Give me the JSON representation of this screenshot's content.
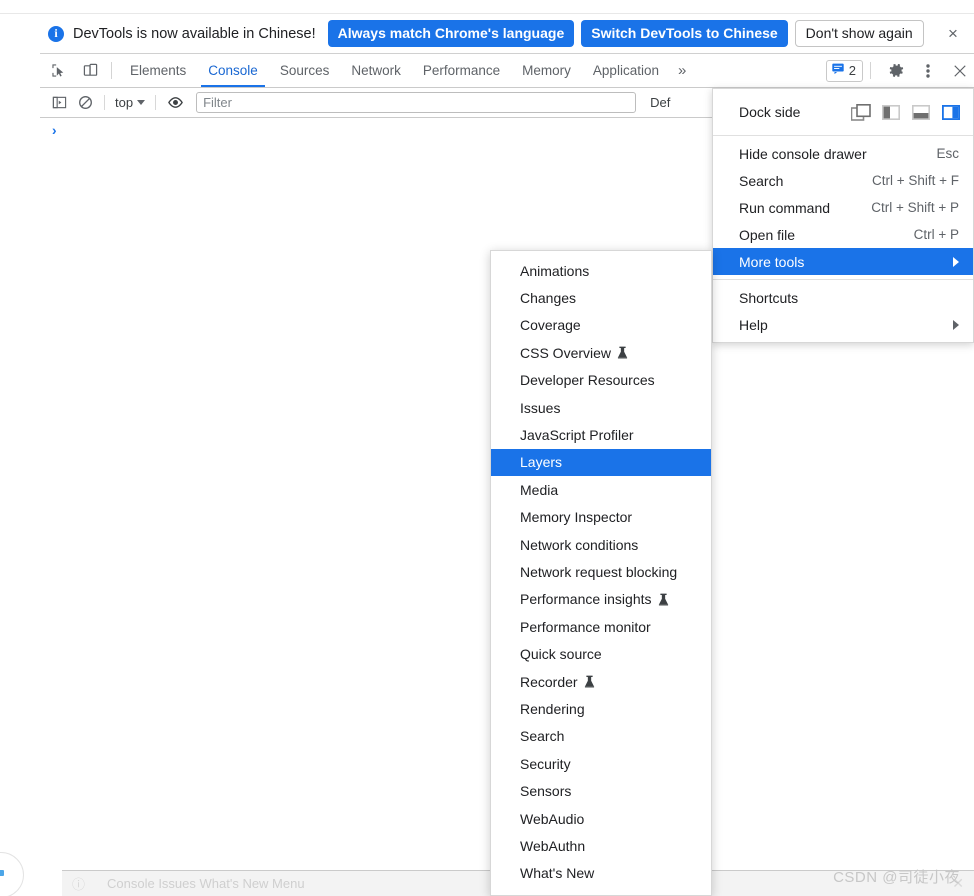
{
  "notification": {
    "icon": "info-icon",
    "message": "DevTools is now available in Chinese!",
    "primary_button_1": "Always match Chrome's language",
    "primary_button_2": "Switch DevTools to Chinese",
    "secondary_button": "Don't show again",
    "close_icon": "×",
    "accent_color": "#1a73e8"
  },
  "tabbar": {
    "inspect_icon": "inspect-element-icon",
    "device_icon": "device-toolbar-icon",
    "tabs": [
      {
        "label": "Elements",
        "active": false
      },
      {
        "label": "Console",
        "active": true
      },
      {
        "label": "Sources",
        "active": false
      },
      {
        "label": "Network",
        "active": false
      },
      {
        "label": "Performance",
        "active": false
      },
      {
        "label": "Memory",
        "active": false
      },
      {
        "label": "Application",
        "active": false
      }
    ],
    "overflow_label": "»",
    "issues_count": "2",
    "issues_icon": "issues-message-icon",
    "settings_icon": "gear-icon",
    "more_icon": "kebab-menu-icon",
    "close_icon": "✕"
  },
  "console_toolbar": {
    "sidebar_icon": "console-sidebar-icon",
    "clear_icon": "clear-console-icon",
    "context_selector": "top",
    "eye_icon": "live-expression-eye-icon",
    "filter_placeholder": "Filter",
    "filter_value": "",
    "levels_label": "Def"
  },
  "console_body": {
    "prompt": "›"
  },
  "bottom_drawer": {
    "info_icon": "info-icon",
    "text": "Console  Issues  What's New  Menu",
    "close_icon": "✕"
  },
  "main_menu": {
    "dock_side": {
      "label": "Dock side",
      "options": [
        {
          "name": "undock-into-separate-window",
          "selected": false
        },
        {
          "name": "dock-to-left",
          "selected": false
        },
        {
          "name": "dock-to-bottom",
          "selected": false
        },
        {
          "name": "dock-to-right",
          "selected": true
        }
      ],
      "selected_color": "#1a73e8"
    },
    "items": [
      {
        "label": "Hide console drawer",
        "shortcut": "Esc",
        "selected": false,
        "has_submenu": false
      },
      {
        "label": "Search",
        "shortcut": "Ctrl + Shift + F",
        "selected": false,
        "has_submenu": false
      },
      {
        "label": "Run command",
        "shortcut": "Ctrl + Shift + P",
        "selected": false,
        "has_submenu": false
      },
      {
        "label": "Open file",
        "shortcut": "Ctrl + P",
        "selected": false,
        "has_submenu": false
      },
      {
        "label": "More tools",
        "shortcut": "",
        "selected": true,
        "has_submenu": true
      }
    ],
    "items_bottom": [
      {
        "label": "Shortcuts",
        "shortcut": "",
        "selected": false,
        "has_submenu": false
      },
      {
        "label": "Help",
        "shortcut": "",
        "selected": false,
        "has_submenu": true
      }
    ]
  },
  "more_tools_submenu": {
    "items": [
      {
        "label": "Animations",
        "experimental": false,
        "selected": false
      },
      {
        "label": "Changes",
        "experimental": false,
        "selected": false
      },
      {
        "label": "Coverage",
        "experimental": false,
        "selected": false
      },
      {
        "label": "CSS Overview",
        "experimental": true,
        "selected": false
      },
      {
        "label": "Developer Resources",
        "experimental": false,
        "selected": false
      },
      {
        "label": "Issues",
        "experimental": false,
        "selected": false
      },
      {
        "label": "JavaScript Profiler",
        "experimental": false,
        "selected": false
      },
      {
        "label": "Layers",
        "experimental": false,
        "selected": true
      },
      {
        "label": "Media",
        "experimental": false,
        "selected": false
      },
      {
        "label": "Memory Inspector",
        "experimental": false,
        "selected": false
      },
      {
        "label": "Network conditions",
        "experimental": false,
        "selected": false
      },
      {
        "label": "Network request blocking",
        "experimental": false,
        "selected": false
      },
      {
        "label": "Performance insights",
        "experimental": true,
        "selected": false
      },
      {
        "label": "Performance monitor",
        "experimental": false,
        "selected": false
      },
      {
        "label": "Quick source",
        "experimental": false,
        "selected": false
      },
      {
        "label": "Recorder",
        "experimental": true,
        "selected": false
      },
      {
        "label": "Rendering",
        "experimental": false,
        "selected": false
      },
      {
        "label": "Search",
        "experimental": false,
        "selected": false
      },
      {
        "label": "Security",
        "experimental": false,
        "selected": false
      },
      {
        "label": "Sensors",
        "experimental": false,
        "selected": false
      },
      {
        "label": "WebAudio",
        "experimental": false,
        "selected": false
      },
      {
        "label": "WebAuthn",
        "experimental": false,
        "selected": false
      },
      {
        "label": "What's New",
        "experimental": false,
        "selected": false
      }
    ],
    "highlight_color": "#1a73e8"
  },
  "watermark": {
    "text": "CSDN @司徒小夜"
  }
}
